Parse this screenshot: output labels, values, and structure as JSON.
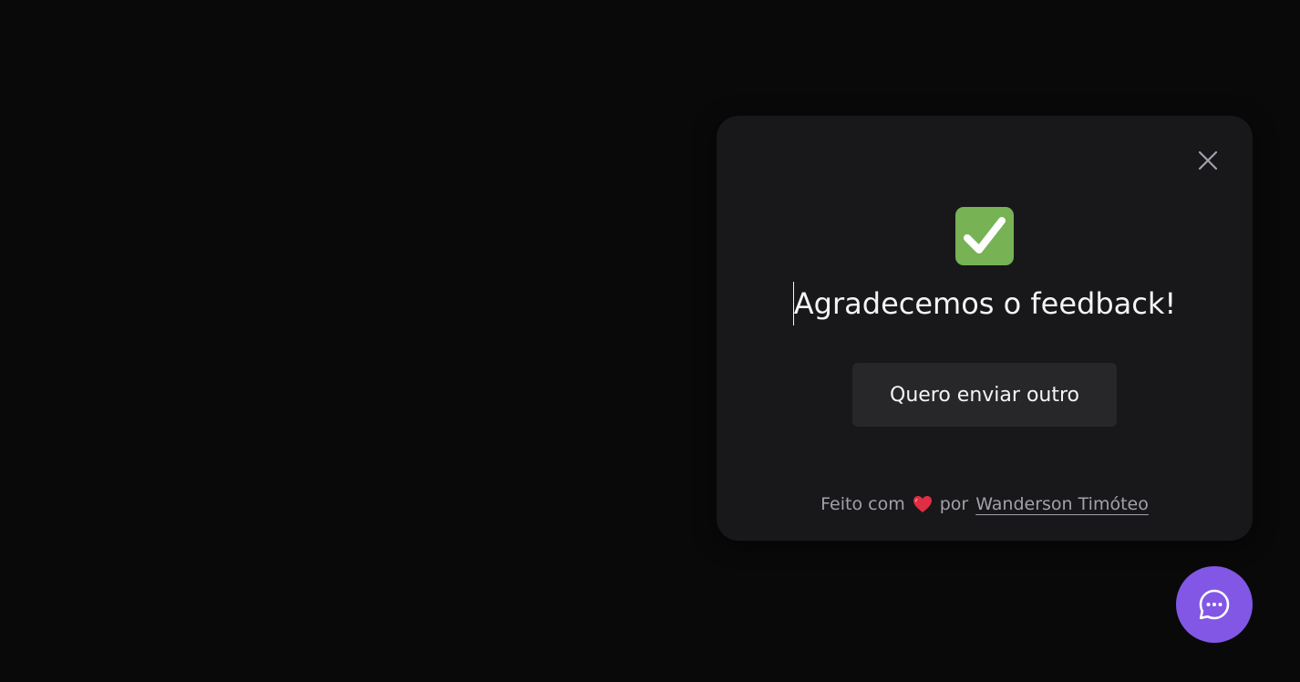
{
  "feedback_widget": {
    "title": "Agradecemos o feedback!",
    "send_another_label": "Quero enviar outro",
    "close_icon": "close-icon",
    "success_icon": "check-mark-icon",
    "footer": {
      "prefix": "Feito com",
      "heart_icon": "heart-icon",
      "middle": "por",
      "author_name": "Wanderson Timóteo"
    }
  },
  "launcher": {
    "icon": "chat-bubble-icon"
  },
  "colors": {
    "background": "#09090a",
    "panel": "#18181b",
    "button": "#27272a",
    "text": "#f4f4f5",
    "muted_text": "#a1a1aa",
    "brand": "#8257e5",
    "success": "#77b255",
    "heart": "#dd2e44"
  }
}
